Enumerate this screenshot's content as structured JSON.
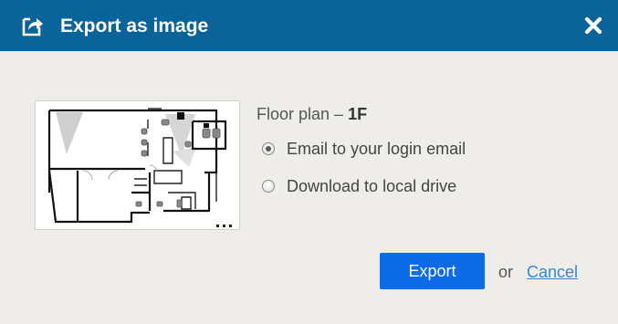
{
  "dialog": {
    "title": "Export as image",
    "title_icon": "export-icon",
    "close_icon": "close-icon"
  },
  "preview": {
    "icon": "floor-plan-thumbnail"
  },
  "plan": {
    "label": "Floor plan – ",
    "floor": "1F"
  },
  "options": [
    {
      "label": "Email to your login email",
      "selected": true
    },
    {
      "label": "Download to local drive",
      "selected": false
    }
  ],
  "actions": {
    "export_label": "Export",
    "or_label": "or",
    "cancel_label": "Cancel"
  },
  "colors": {
    "titlebar": "#0a6399",
    "background": "#efede9",
    "export_button": "#0e6be8",
    "cancel_link": "#3a86c8"
  }
}
